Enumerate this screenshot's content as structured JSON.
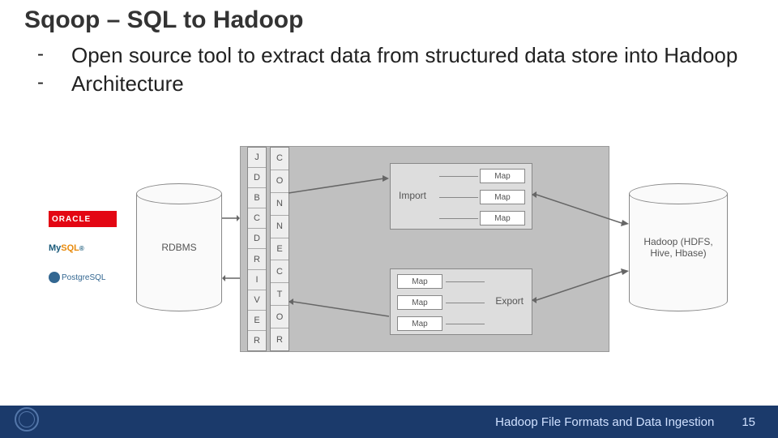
{
  "title": "Sqoop – SQL to Hadoop",
  "bullets": [
    "Open source tool to extract data from structured data store into Hadoop",
    "Architecture"
  ],
  "diagram": {
    "db_logos": {
      "oracle": "ORACLE",
      "mysql_a": "My",
      "mysql_b": "SQL",
      "postgres": "PostgreSQL"
    },
    "rdbms_label": "RDBMS",
    "hadoop_label": "Hadoop (HDFS, Hive, Hbase)",
    "jdbc_driver_letters": [
      "J",
      "D",
      "B",
      "C",
      "D",
      "R",
      "I",
      "V",
      "E",
      "R"
    ],
    "connector_letters": [
      "C",
      "O",
      "N",
      "N",
      "E",
      "C",
      "T",
      "O",
      "R"
    ],
    "import_label": "Import",
    "export_label": "Export",
    "map_label": "Map"
  },
  "footer": {
    "title": "Hadoop File Formats and Data Ingestion",
    "page": "15"
  }
}
